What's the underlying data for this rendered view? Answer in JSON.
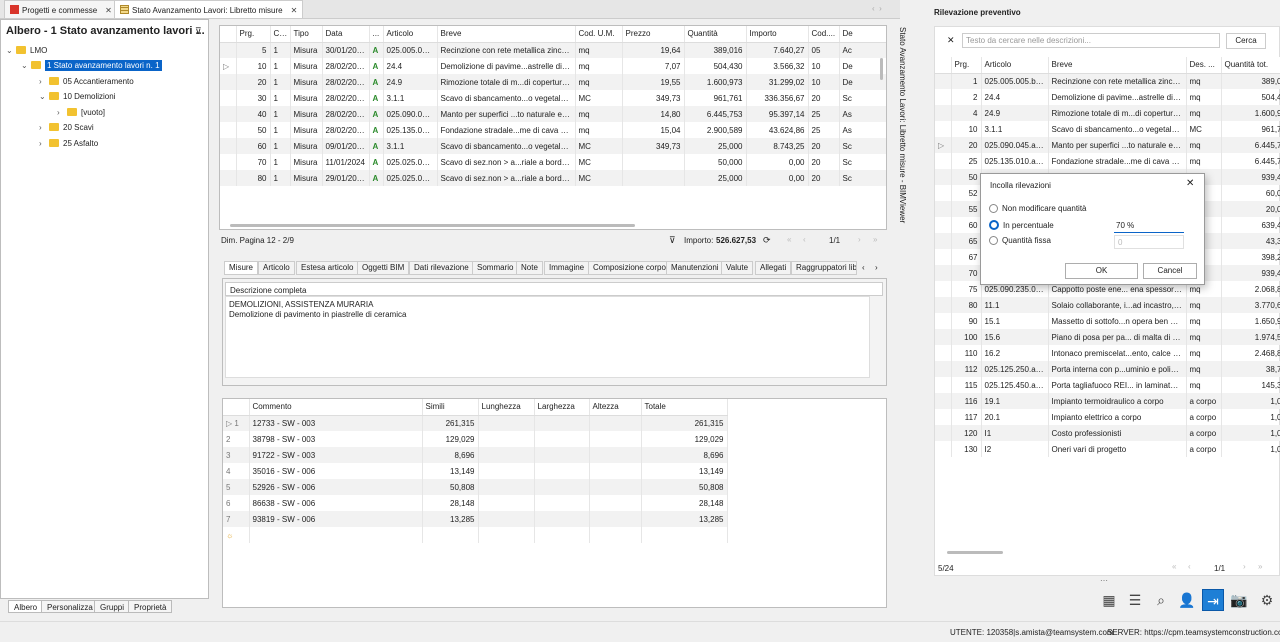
{
  "doc_tabs": [
    {
      "label": "Progetti e commesse"
    },
    {
      "label": "Stato Avanzamento Lavori: Libretto misure"
    }
  ],
  "tree": {
    "title": "Albero - 1 Stato avanzamento lavori ...",
    "nodes": [
      {
        "label": "LMO"
      },
      {
        "label": "1 Stato avanzamento lavori n. 1"
      },
      {
        "label": "05 Accantieramento"
      },
      {
        "label": "10 Demolizioni"
      },
      {
        "label": "[vuoto]"
      },
      {
        "label": "20 Scavi"
      },
      {
        "label": "25 Asfalto"
      }
    ],
    "bottom_tabs": [
      "Albero",
      "Personalizza",
      "Gruppi",
      "Proprietà"
    ]
  },
  "main_grid": {
    "headers": [
      "Prg.",
      "Cod....",
      "Tipo",
      "Data",
      "...",
      "Articolo",
      "Breve",
      "Cod. U.M.",
      "Prezzo",
      "Quantità",
      "Importo",
      "Cod....",
      "De"
    ],
    "rows": [
      [
        "5",
        "1",
        "Misura",
        "30/01/2020",
        "A",
        "025.005.005...",
        "Recinzione con rete metallica zincata",
        "mq",
        "19,64",
        "389,016",
        "7.640,27",
        "05",
        "Ac"
      ],
      [
        "10",
        "1",
        "Misura",
        "28/02/2020",
        "A",
        "24.4",
        "Demolizione di pavime...astrelle di ceramica",
        "mq",
        "7,07",
        "504,430",
        "3.566,32",
        "10",
        "De"
      ],
      [
        "20",
        "1",
        "Misura",
        "28/02/2020",
        "A",
        "24.9",
        "Rimozione totale di m...di copertura a tetto",
        "mq",
        "19,55",
        "1.600,973",
        "31.299,02",
        "10",
        "De"
      ],
      [
        "30",
        "1",
        "Misura",
        "28/02/2020",
        "A",
        "3.1.1",
        "Scavo di sbancamento...o vegetale e simili",
        "MC",
        "349,73",
        "961,761",
        "336.356,67",
        "20",
        "Sc"
      ],
      [
        "40",
        "1",
        "Misura",
        "28/02/2020",
        "A",
        "025.090.045...",
        "Manto per superfici ...to naturale e sabbia",
        "mq",
        "14,80",
        "6.445,753",
        "95.397,14",
        "25",
        "As"
      ],
      [
        "50",
        "1",
        "Misura",
        "28/02/2020",
        "A",
        "025.135.010...",
        "Fondazione stradale...me di cava da cm 20",
        "mq",
        "15,04",
        "2.900,589",
        "43.624,86",
        "25",
        "As"
      ],
      [
        "60",
        "1",
        "Misura",
        "09/01/2024",
        "A",
        "3.1.1",
        "Scavo di sbancamento...o vegetale e simili",
        "MC",
        "349,73",
        "25,000",
        "8.743,25",
        "20",
        "Sc"
      ],
      [
        "70",
        "1",
        "Misura",
        "11/01/2024",
        "A",
        "025.025.010...",
        "Scavo di sez.non > a...riale a bordo scavo",
        "MC",
        "",
        "50,000",
        "0,00",
        "20",
        "Sc"
      ],
      [
        "80",
        "1",
        "Misura",
        "29/01/2024",
        "A",
        "025.025.010...",
        "Scavo di sez.non > a...riale a bordo scavo",
        "MC",
        "",
        "25,000",
        "0,00",
        "20",
        "Sc"
      ]
    ],
    "page_info": "Dim. Pagina  12  - 2/9",
    "importo_label": "Importo:",
    "importo_value": "526.627,53",
    "page_nav": "1/1"
  },
  "sub_tabs": [
    "Misure",
    "Articolo",
    "Estesa articolo",
    "Oggetti BIM",
    "Dati rilevazione",
    "Sommario",
    "Note",
    "Immagine",
    "Composizione corpo",
    "Manutenzioni",
    "Valute",
    "Allegati",
    "Raggruppatori libe"
  ],
  "description": {
    "tab": "Descrizione completa",
    "line1": "DEMOLIZIONI, ASSISTENZA MURARIA",
    "line2": "Demolizione di pavimento in piastrelle di ceramica"
  },
  "measures": {
    "headers": [
      "Commento",
      "Simili",
      "Lunghezza",
      "Larghezza",
      "Altezza",
      "Totale"
    ],
    "rows": [
      [
        "1",
        "12733 - SW - 003",
        "261,315",
        "",
        "",
        "",
        "261,315"
      ],
      [
        "2",
        "38798 - SW - 003",
        "129,029",
        "",
        "",
        "",
        "129,029"
      ],
      [
        "3",
        "91722 - SW - 003",
        "8,696",
        "",
        "",
        "",
        "8,696"
      ],
      [
        "4",
        "35016 - SW - 006",
        "13,149",
        "",
        "",
        "",
        "13,149"
      ],
      [
        "5",
        "52926 - SW - 006",
        "50,808",
        "",
        "",
        "",
        "50,808"
      ],
      [
        "6",
        "86638 - SW - 006",
        "28,148",
        "",
        "",
        "",
        "28,148"
      ],
      [
        "7",
        "93819 - SW - 006",
        "13,285",
        "",
        "",
        "",
        "13,285"
      ]
    ]
  },
  "side_label": "Stato Avanzamento Lavori: Libretto misure - BIMViewer",
  "right_panel": {
    "title": "Rilevazione preventivo",
    "search_placeholder": "Testo da cercare nelle descrizioni...",
    "search_button": "Cerca",
    "headers": [
      "Prg.",
      "Articolo",
      "Breve",
      "Des. ...",
      "Quantità tot."
    ],
    "rows": [
      [
        "1",
        "025.005.005.b00",
        "Recinzione con rete metallica zincata",
        "mq",
        "389,0"
      ],
      [
        "2",
        "24.4",
        "Demolizione di pavime...astrelle di ceramica",
        "mq",
        "504,4"
      ],
      [
        "4",
        "24.9",
        "Rimozione totale di m...di copertura a tetto",
        "mq",
        "1.600,9"
      ],
      [
        "10",
        "3.1.1",
        "Scavo di sbancamento...o vegetale e simili",
        "MC",
        "961,7"
      ],
      [
        "20",
        "025.090.045.a00",
        "Manto per superfici ...to naturale e sabbia",
        "mq",
        "6.445,7"
      ],
      [
        "25",
        "025.135.010.a00",
        "Fondazione stradale...me di cava da cm 20",
        "mq",
        "6.445,7"
      ],
      [
        "50",
        "",
        "",
        "",
        "939,4"
      ],
      [
        "52",
        "",
        "",
        "",
        "60,0"
      ],
      [
        "55",
        "",
        "",
        "",
        "20,0"
      ],
      [
        "60",
        "",
        "",
        "",
        "639,4"
      ],
      [
        "65",
        "",
        "",
        "",
        "43,3"
      ],
      [
        "67",
        "",
        "",
        "",
        "398,2"
      ],
      [
        "70",
        "",
        "",
        "",
        "939,4"
      ],
      [
        "75",
        "025.090.235.000",
        "Cappotto poste ene... ena spessore mm",
        "mq",
        "2.068,8"
      ],
      [
        "80",
        "11.1",
        "Solaio collaborante, i...ad incastro, fornito",
        "mq",
        "3.770,6"
      ],
      [
        "90",
        "15.1",
        "Massetto di sottofo...n opera ben battuto",
        "mq",
        "1.650,9"
      ],
      [
        "100",
        "15.6",
        "Piano di posa per pa... di malta di cemento",
        "mq",
        "1.974,5"
      ],
      [
        "110",
        "16.2",
        "Intonaco premiscelat...ento, calce idrata,",
        "mq",
        "2.468,8"
      ],
      [
        "112",
        "025.125.250.a00",
        "Porta interna con p...uminio e poliuretano",
        "mq",
        "38,7"
      ],
      [
        "115",
        "025.125.450.a00",
        "Porta tagliafuoco REI... in laminato plastico",
        "mq",
        "145,3"
      ],
      [
        "116",
        "19.1",
        "Impianto termoidraulico a corpo",
        "a corpo",
        "1,0"
      ],
      [
        "117",
        "20.1",
        "Impianto elettrico a corpo",
        "a corpo",
        "1,0"
      ],
      [
        "120",
        "I1",
        "Costo professionisti",
        "a corpo",
        "1,0"
      ],
      [
        "130",
        "I2",
        "Oneri vari di progetto",
        "a corpo",
        "1,0"
      ]
    ],
    "count": "5/24",
    "page_nav": "1/1"
  },
  "dialog": {
    "title": "Incolla rilevazioni",
    "opt1": "Non modificare quantità",
    "opt2": "In percentuale",
    "opt3": "Quantità fissa",
    "value": "70 %",
    "fixed_value": "0",
    "ok": "OK",
    "cancel": "Cancel"
  },
  "status": {
    "user": "UTENTE:  120358|s.amista@teamsystem.com",
    "server": "SERVER:  https://cpm.teamsystemconstruction.com"
  }
}
